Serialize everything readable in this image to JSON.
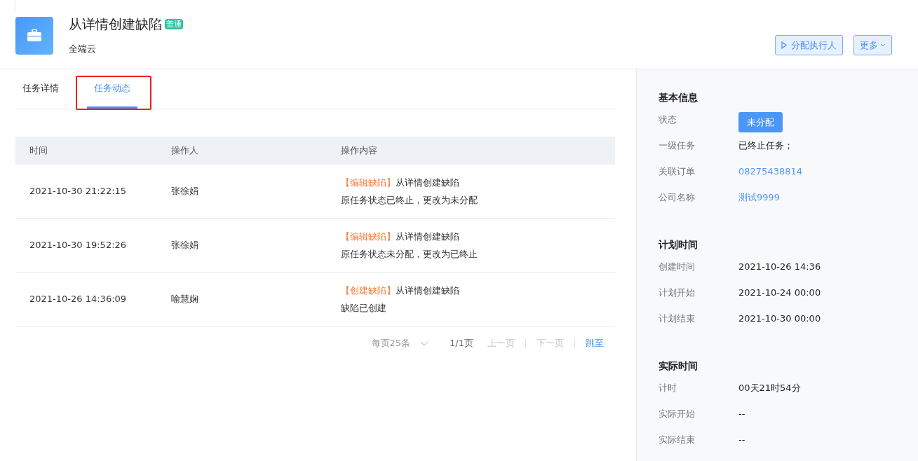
{
  "header": {
    "title": "从详情创建缺陷",
    "badge": "普通",
    "subtitle": "全端云",
    "actions": [
      {
        "label": "分配执行人",
        "kind": "assign"
      },
      {
        "label": "更多",
        "kind": "more"
      }
    ]
  },
  "tabs": [
    {
      "label": "任务详情",
      "selected": false
    },
    {
      "label": "任务动态",
      "selected": true
    }
  ],
  "table": {
    "columns": [
      "时间",
      "操作人",
      "操作内容"
    ],
    "rows": [
      {
        "time": "2021-10-30 21:22:15",
        "operator": "张徐娟",
        "tag": "【编辑缺陷】",
        "action": "从详情创建缺陷",
        "detail": "原任务状态已终止，更改为未分配"
      },
      {
        "time": "2021-10-30 19:52:26",
        "operator": "张徐娟",
        "tag": "【编辑缺陷】",
        "action": "从详情创建缺陷",
        "detail": "原任务状态未分配，更改为已终止"
      },
      {
        "time": "2021-10-26 14:36:09",
        "operator": "喻慧娴",
        "tag": "【创建缺陷】",
        "action": "从详情创建缺陷",
        "detail": "缺陷已创建"
      }
    ]
  },
  "pagination": {
    "page_size": "每页25条",
    "page": "1/1页",
    "prev": "上一页",
    "next": "下一页",
    "jump": "跳至"
  },
  "sidebar": {
    "sections": [
      {
        "title": "基本信息",
        "fields": [
          {
            "label": "状态",
            "value": "未分配",
            "kind": "badge"
          },
          {
            "label": "一级任务",
            "value": "已终止任务；",
            "kind": "text"
          },
          {
            "label": "关联订单",
            "value": "08275438814",
            "kind": "link"
          },
          {
            "label": "公司名称",
            "value": "测试9999",
            "kind": "link"
          }
        ]
      },
      {
        "title": "计划时间",
        "fields": [
          {
            "label": "创建时间",
            "value": "2021-10-26 14:36",
            "kind": "text"
          },
          {
            "label": "计划开始",
            "value": "2021-10-24 00:00",
            "kind": "text"
          },
          {
            "label": "计划结束",
            "value": "2021-10-30 00:00",
            "kind": "text"
          }
        ]
      },
      {
        "title": "实际时间",
        "fields": [
          {
            "label": "计时",
            "value": "00天21时54分",
            "kind": "text"
          },
          {
            "label": "实际开始",
            "value": "--",
            "kind": "text"
          },
          {
            "label": "实际结束",
            "value": "--",
            "kind": "text"
          }
        ]
      }
    ]
  }
}
